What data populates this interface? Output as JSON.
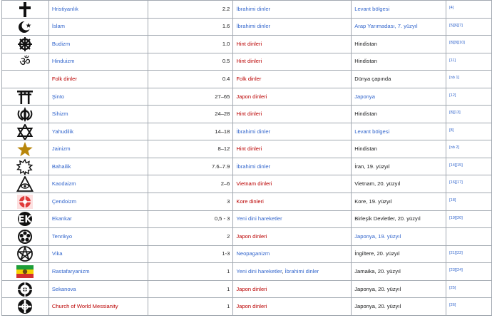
{
  "rows": [
    {
      "symbol": "latin-cross-icon",
      "name": "Hristiyanlık",
      "name_color": "blue",
      "pct": "2.2",
      "family": [
        {
          "text": "İbrahimi dinler",
          "color": "blue"
        }
      ],
      "region": "Levant bölgesi",
      "region_color": "blue",
      "ref": "[4]"
    },
    {
      "symbol": "star-crescent-icon",
      "name": "İslam",
      "name_color": "blue",
      "pct": "1.6",
      "family": [
        {
          "text": "İbrahimi dinler",
          "color": "blue"
        }
      ],
      "region": "Arap Yarımadası, 7. yüzyıl",
      "region_color": "blue",
      "ref": "[5][6][7]"
    },
    {
      "symbol": "dharma-wheel-icon",
      "name": "Budizm",
      "name_color": "blue",
      "pct": "1.0",
      "family": [
        {
          "text": "Hint dinleri",
          "color": "red"
        }
      ],
      "region": "Hindistan",
      "region_color": "dark",
      "ref": "[8][9][10]"
    },
    {
      "symbol": "om-icon",
      "name": "Hinduizm",
      "name_color": "blue",
      "pct": "0.5",
      "family": [
        {
          "text": "Hint dinleri",
          "color": "red"
        }
      ],
      "region": "Hindistan",
      "region_color": "dark",
      "ref": "[11]"
    },
    {
      "symbol": "",
      "name": "Folk dinler",
      "name_color": "red",
      "pct": "0.4",
      "family": [
        {
          "text": "Folk dinler",
          "color": "red"
        }
      ],
      "region": "Dünya çapında",
      "region_color": "dark",
      "ref": "[nb 1]"
    },
    {
      "symbol": "torii-gate-icon",
      "name": "Şinto",
      "name_color": "blue",
      "pct": "27–65",
      "family": [
        {
          "text": "Japon dinleri",
          "color": "red"
        }
      ],
      "region": "Japonya",
      "region_color": "blue",
      "ref": "[12]"
    },
    {
      "symbol": "khanda-icon",
      "name": "Sihizm",
      "name_color": "blue",
      "pct": "24–28",
      "family": [
        {
          "text": "Hint dinleri",
          "color": "red"
        }
      ],
      "region": "Hindistan",
      "region_color": "dark",
      "ref": "[8][13]"
    },
    {
      "symbol": "star-of-david-icon",
      "name": "Yahudilik",
      "name_color": "blue",
      "pct": "14–18",
      "family": [
        {
          "text": "İbrahimi dinler",
          "color": "blue"
        }
      ],
      "region": "Levant bölgesi",
      "region_color": "blue",
      "ref": "[8]"
    },
    {
      "symbol": "jain-symbol-icon",
      "name": "Jainizm",
      "name_color": "blue",
      "pct": "8–12",
      "family": [
        {
          "text": "Hint dinleri",
          "color": "red"
        }
      ],
      "region": "Hindistan",
      "region_color": "dark",
      "ref": "[nb 2]"
    },
    {
      "symbol": "nine-pointed-star-icon",
      "name": "Bahailik",
      "name_color": "blue",
      "pct": "7.6–7.9",
      "family": [
        {
          "text": "İbrahimi dinler",
          "color": "blue"
        }
      ],
      "region": "İran, 19. yüzyıl",
      "region_color": "dark",
      "ref": "[14][15]"
    },
    {
      "symbol": "caodaism-eye-icon",
      "name": "Kaodaizm",
      "name_color": "blue",
      "pct": "2–6",
      "family": [
        {
          "text": "Vietnam dinleri",
          "color": "red"
        }
      ],
      "region": "Vietnam, 20. yüzyıl",
      "region_color": "dark",
      "ref": "[16][17]"
    },
    {
      "symbol": "cheondoism-icon",
      "name": "Çendoizm",
      "name_color": "blue",
      "pct": "3",
      "family": [
        {
          "text": "Kore dinleri",
          "color": "red"
        }
      ],
      "region": "Kore, 19. yüzyıl",
      "region_color": "dark",
      "ref": "[18]"
    },
    {
      "symbol": "eckankar-icon",
      "name": "Ekankar",
      "name_color": "blue",
      "pct": "0,5 - 3",
      "family": [
        {
          "text": "Yeni dini hareketler",
          "color": "blue"
        }
      ],
      "region": "Birleşik Devletler, 20. yüzyıl",
      "region_color": "dark",
      "ref": "[19][20]"
    },
    {
      "symbol": "tenrikyo-icon",
      "name": "Tenrikyo",
      "name_color": "blue",
      "pct": "2",
      "family": [
        {
          "text": "Japon dinleri",
          "color": "red"
        }
      ],
      "region": "Japonya, 19. yüzyıl",
      "region_color": "blue",
      "ref": ""
    },
    {
      "symbol": "pentacle-icon",
      "name": "Vika",
      "name_color": "blue",
      "pct": "1-3",
      "family": [
        {
          "text": "Neopaganizm",
          "color": "blue"
        }
      ],
      "region": "İngiltere, 20. yüzyıl",
      "region_color": "dark",
      "ref": "[21][22]"
    },
    {
      "symbol": "rastafari-flag-icon",
      "name": "Rastafaryanizm",
      "name_color": "blue",
      "pct": "1",
      "family": [
        {
          "text": "Yeni dini hareketler",
          "color": "blue"
        },
        {
          "text": "İbrahimi dinler",
          "color": "blue"
        }
      ],
      "region": "Jamaika, 20. yüzyıl",
      "region_color": "dark",
      "ref": "[23][24]"
    },
    {
      "symbol": "seicho-no-ie-icon",
      "name": "Sekanova",
      "name_color": "blue",
      "pct": "1",
      "family": [
        {
          "text": "Japon dinleri",
          "color": "red"
        }
      ],
      "region": "Japonya, 20. yüzyıl",
      "region_color": "dark",
      "ref": "[25]"
    },
    {
      "symbol": "world-messianity-icon",
      "name": "Church of World Messianity",
      "name_color": "red",
      "pct": "1",
      "family": [
        {
          "text": "Japon dinleri",
          "color": "red"
        }
      ],
      "region": "Japonya, 20. yüzyıl",
      "region_color": "dark",
      "ref": "[26]"
    }
  ]
}
